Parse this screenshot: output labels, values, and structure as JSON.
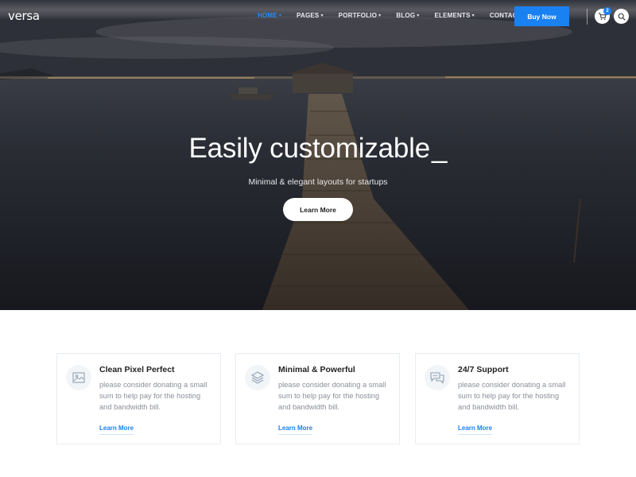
{
  "brand": {
    "logo_text": "versa"
  },
  "nav": {
    "items": [
      {
        "label": "HOME",
        "active": true
      },
      {
        "label": "PAGES",
        "active": false
      },
      {
        "label": "PORTFOLIO",
        "active": false
      },
      {
        "label": "BLOG",
        "active": false
      },
      {
        "label": "ELEMENTS",
        "active": false
      },
      {
        "label": "CONTACT",
        "active": false
      }
    ],
    "caret": "▾",
    "buy_label": "Buy Now",
    "cart_count": "2"
  },
  "hero": {
    "headline": "Easily customizable",
    "cursor": "_",
    "subheadline": "Minimal & elegant layouts for startups",
    "button_label": "Learn More"
  },
  "features": [
    {
      "icon": "image-icon",
      "title": "Clean Pixel Perfect",
      "text": "please consider donating a small sum to help pay for the hosting and bandwidth bill.",
      "link": "Learn More"
    },
    {
      "icon": "layers-icon",
      "title": "Minimal & Powerful",
      "text": "please consider donating a small sum to help pay for the hosting and bandwidth bill.",
      "link": "Learn More"
    },
    {
      "icon": "chat-icon",
      "title": "24/7 Support",
      "text": "please consider donating a small sum to help pay for the hosting and bandwidth bill.",
      "link": "Learn More"
    }
  ],
  "colors": {
    "accent": "#1a81f2",
    "hero_dark": "#1d2129",
    "text_muted": "#8a8f98"
  }
}
